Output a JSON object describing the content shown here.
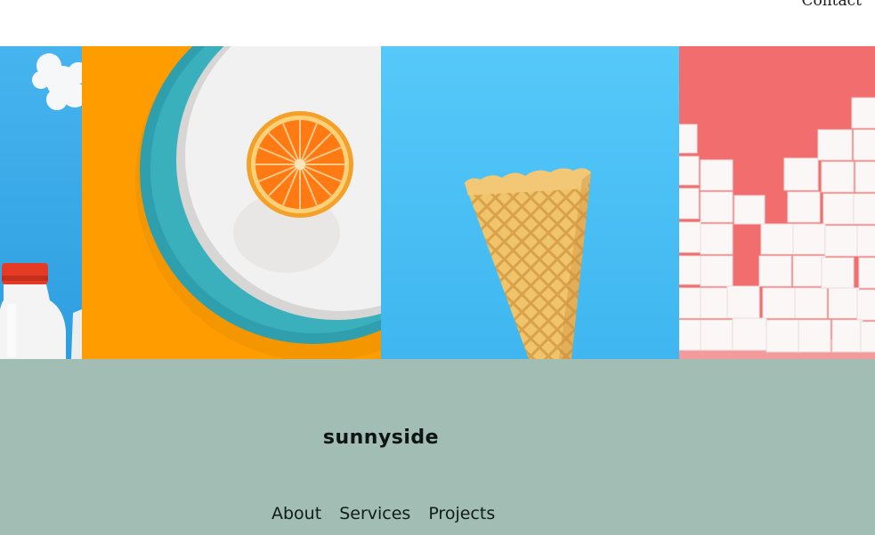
{
  "header": {
    "nav_contact": "Contact"
  },
  "gallery": {
    "images": [
      {
        "name": "milk-bottles",
        "bg": "#3eaae8"
      },
      {
        "name": "orange-on-plate",
        "bg": "#ff9d00"
      },
      {
        "name": "ice-cream-cone",
        "bg": "#4ec3f5"
      },
      {
        "name": "sugar-cubes",
        "bg": "#f06e6a"
      }
    ]
  },
  "footer": {
    "logo": "sunnyside",
    "bg_color": "#a2bdb4",
    "links": [
      "About",
      "Services",
      "Projects"
    ]
  }
}
